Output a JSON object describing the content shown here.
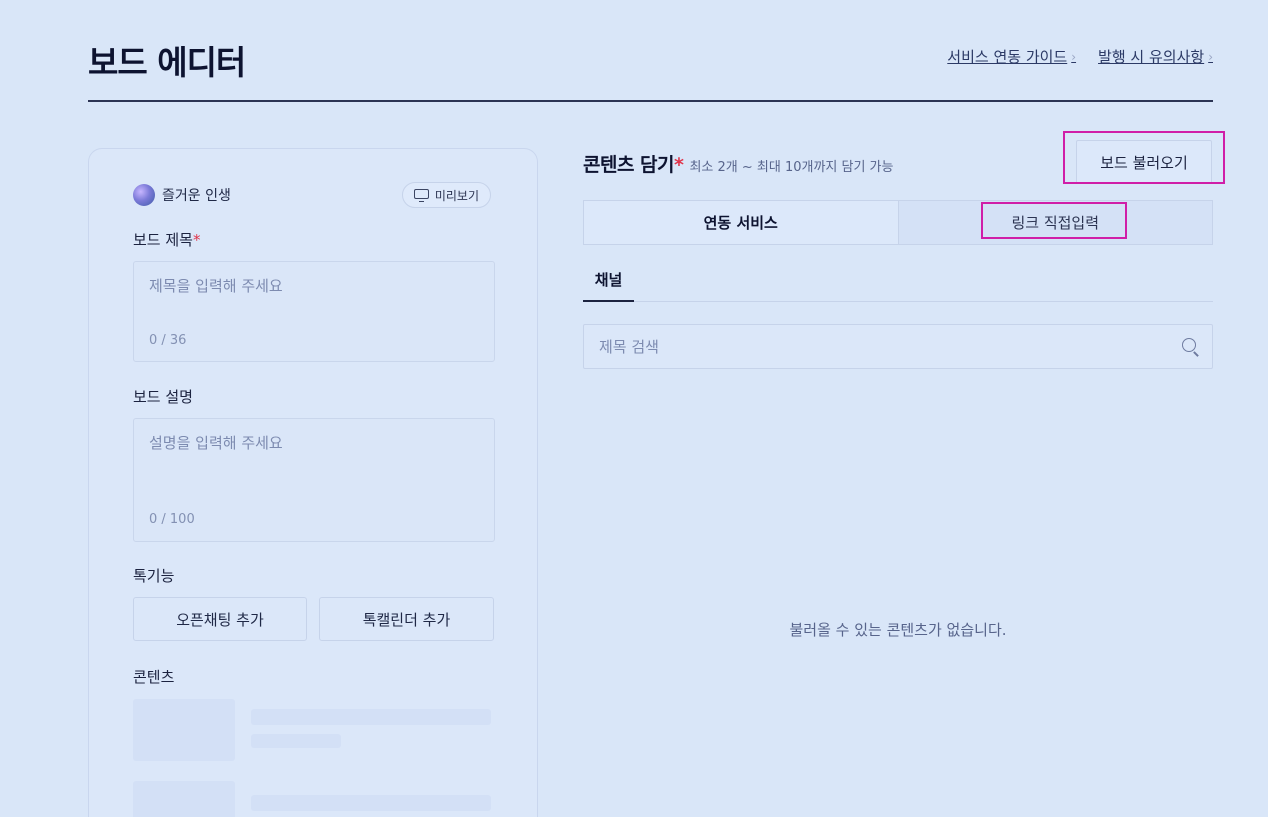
{
  "header": {
    "title": "보드 에디터",
    "links": [
      {
        "label": "서비스 연동 가이드",
        "chevron": "›"
      },
      {
        "label": "발행 시 유의사항",
        "chevron": "›"
      }
    ]
  },
  "profile": {
    "name": "즐거운 인생"
  },
  "preview": {
    "label": "미리보기"
  },
  "board_title": {
    "label": "보드 제목",
    "required_mark": "*",
    "placeholder": "제목을 입력해 주세요",
    "count": "0 / 36"
  },
  "board_desc": {
    "label": "보드 설명",
    "placeholder": "설명을 입력해 주세요",
    "count": "0 / 100"
  },
  "talk": {
    "label": "톡기능",
    "openchat_label": "오픈채팅 추가",
    "calendar_label": "톡캘린더 추가"
  },
  "contents_label": "콘텐츠",
  "content_section": {
    "title": "콘텐츠 담기",
    "required_mark": "*",
    "subtitle": "최소 2개 ~ 최대 10개까지 담기 가능",
    "load_label": "보드 불러오기"
  },
  "tabs": [
    {
      "label": "연동 서비스",
      "active": true
    },
    {
      "label": "링크 직접입력",
      "active": false
    }
  ],
  "subtab": {
    "label": "채널"
  },
  "search": {
    "placeholder": "제목 검색"
  },
  "empty_message": "불러올 수 있는 콘텐츠가 없습니다.",
  "colors": {
    "highlight": "#d01ea8",
    "required": "#e0344a",
    "background": "#d9e6f8"
  }
}
